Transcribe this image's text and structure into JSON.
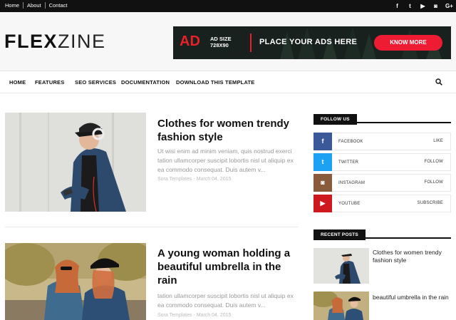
{
  "topbar": {
    "links": [
      "Home",
      "About",
      "Contact"
    ],
    "social_icons": [
      "facebook-icon",
      "twitter-icon",
      "youtube-icon",
      "instagram-icon",
      "google-plus-icon"
    ],
    "social_glyphs": [
      "f",
      "t",
      "▶",
      "◙",
      "G+"
    ]
  },
  "header": {
    "logo_bold": "FLEX",
    "logo_light": "ZINE"
  },
  "ad": {
    "ad_label": "AD",
    "size_line1": "AD SIZE",
    "size_line2": "728X90",
    "text": "PLACE YOUR ADS HERE",
    "button": "KNOW MORE",
    "accent_color": "#e8202a"
  },
  "nav": {
    "items": [
      "HOME",
      "FEATURES",
      "SEO SERVICES",
      "DOCUMENTATION",
      "DOWNLOAD THIS TEMPLATE"
    ]
  },
  "posts": [
    {
      "title_line1": "Clothes for women trendy",
      "title_line2": "fashion style",
      "excerpt_line1": "Ut wisi enim ad minim veniam, quis nostrud exerci",
      "excerpt_line2": "tation ullamcorper suscipit lobortis nisl ut aliquip ex",
      "excerpt_line3": "ea commodo consequat. Duis autem v...",
      "meta": "Sora Templates - March 04, 2015"
    },
    {
      "title_line1": "A young woman holding a",
      "title_line2": "beautiful umbrella in the",
      "title_line3": "rain",
      "excerpt_line2": "tation ullamcorper suscipit lobortis nisl ut aliquip ex",
      "excerpt_line3": "ea commodo consequat. Duis autem v...",
      "meta": "Sora Templates - March 04, 2015"
    }
  ],
  "sidebar": {
    "follow_title": "FOLLOW US",
    "follow": [
      {
        "name": "FACEBOOK",
        "action": "LIKE",
        "glyph": "f",
        "color": "#3b5998"
      },
      {
        "name": "TWITTER",
        "action": "FOLLOW",
        "glyph": "t",
        "color": "#1da1f2"
      },
      {
        "name": "INSTAGRAM",
        "action": "FOLLOW",
        "glyph": "◙",
        "color": "#8a5a3c"
      },
      {
        "name": "YOUTUBE",
        "action": "SUBSCRIBE",
        "glyph": "▶",
        "color": "#cc181e"
      }
    ],
    "recent_title": "RECENT POSTS",
    "recent": [
      {
        "title_line1": "Clothes for women trendy",
        "title_line2": "fashion style"
      },
      {
        "title_line1": "beautiful umbrella in the rain"
      }
    ]
  }
}
